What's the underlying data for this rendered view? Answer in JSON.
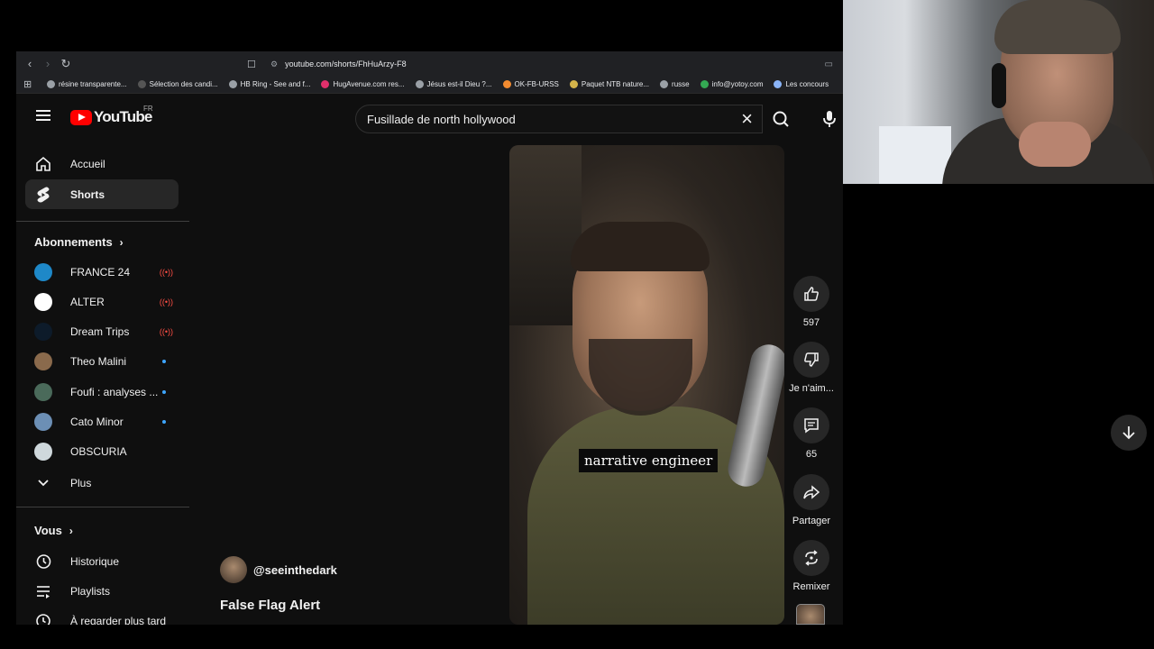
{
  "browser": {
    "url": "youtube.com/shorts/FhHuArzy-F8",
    "bookmarks": [
      {
        "label": "résine transparente...",
        "color": "#9aa0a6"
      },
      {
        "label": "Sélection des candi...",
        "color": "#555"
      },
      {
        "label": "HB Ring - See and f...",
        "color": "#9aa0a6"
      },
      {
        "label": "HugAvenue.com res...",
        "color": "#e1306c"
      },
      {
        "label": "Jésus est-il Dieu ?...",
        "color": "#9aa0a6"
      },
      {
        "label": "OK-FB-URSS",
        "color": "#f28b30"
      },
      {
        "label": "Paquet NTB nature...",
        "color": "#d4b44a"
      },
      {
        "label": "russe",
        "color": "#9aa0a6"
      },
      {
        "label": "info@yotoy.com",
        "color": "#34a853"
      },
      {
        "label": "Les concours",
        "color": "#8ab4f8"
      }
    ]
  },
  "youtube": {
    "logo_text": "YouTube",
    "country": "FR",
    "search_query": "Fusillade de north hollywood"
  },
  "sidebar": {
    "main": [
      {
        "label": "Accueil",
        "icon": "home-icon"
      },
      {
        "label": "Shorts",
        "icon": "shorts-icon"
      }
    ],
    "subscriptions_title": "Abonnements",
    "subscriptions": [
      {
        "label": "FRANCE 24",
        "status": "live",
        "color": "#1e88c8"
      },
      {
        "label": "ALTER",
        "status": "live",
        "color": "#ffffff"
      },
      {
        "label": "Dream Trips",
        "status": "live",
        "color": "#0d1b2a"
      },
      {
        "label": "Theo Malini",
        "status": "new",
        "color": "#8a6a4c"
      },
      {
        "label": "Foufi : analyses ...",
        "status": "new",
        "color": "#4a6a5a"
      },
      {
        "label": "Cato Minor",
        "status": "new",
        "color": "#6c8fb5"
      },
      {
        "label": "OBSCURIA",
        "status": "",
        "color": "#cfd8dc"
      }
    ],
    "more_label": "Plus",
    "you_title": "Vous",
    "you_items": [
      {
        "label": "Historique",
        "icon": "history-icon"
      },
      {
        "label": "Playlists",
        "icon": "playlists-icon"
      },
      {
        "label": "À regarder plus tard",
        "icon": "clock-icon"
      }
    ]
  },
  "short": {
    "caption": "narrative engineer",
    "channel": "@seeinthedark",
    "title": "False Flag Alert",
    "likes": "597",
    "dislike_label": "Je n'aim...",
    "comments": "65",
    "share_label": "Partager",
    "remix_label": "Remixer"
  }
}
